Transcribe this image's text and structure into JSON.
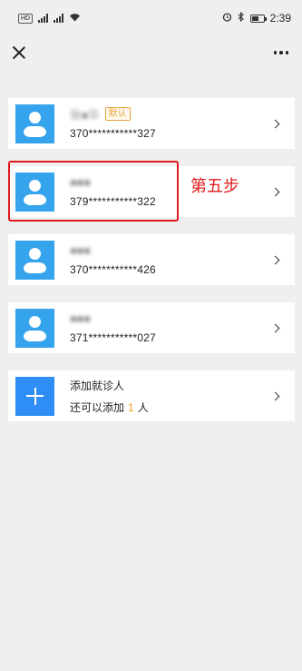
{
  "status_bar": {
    "left_chips": [
      "HD",
      "5G",
      "5G"
    ],
    "time": "2:39"
  },
  "nav": {
    "close_icon": "close-icon",
    "more_icon": "more-icon"
  },
  "patients": [
    {
      "name": "张■华",
      "id": "370***********327",
      "badge": "默认"
    },
    {
      "name": "■■■",
      "id": "379***********322",
      "badge": ""
    },
    {
      "name": "■■■",
      "id": "370***********426",
      "badge": ""
    },
    {
      "name": "■■■",
      "id": "371***********027",
      "badge": ""
    }
  ],
  "add_patient": {
    "title": "添加就诊人",
    "sub_prefix": "还可以添加",
    "remaining": "1",
    "sub_suffix": "人"
  },
  "annotation": {
    "label": "第五步",
    "color": "#e0191b"
  },
  "colors": {
    "avatar": "#35a4ec",
    "add_button": "#2f8ef5",
    "badge": "#e6a23c"
  }
}
